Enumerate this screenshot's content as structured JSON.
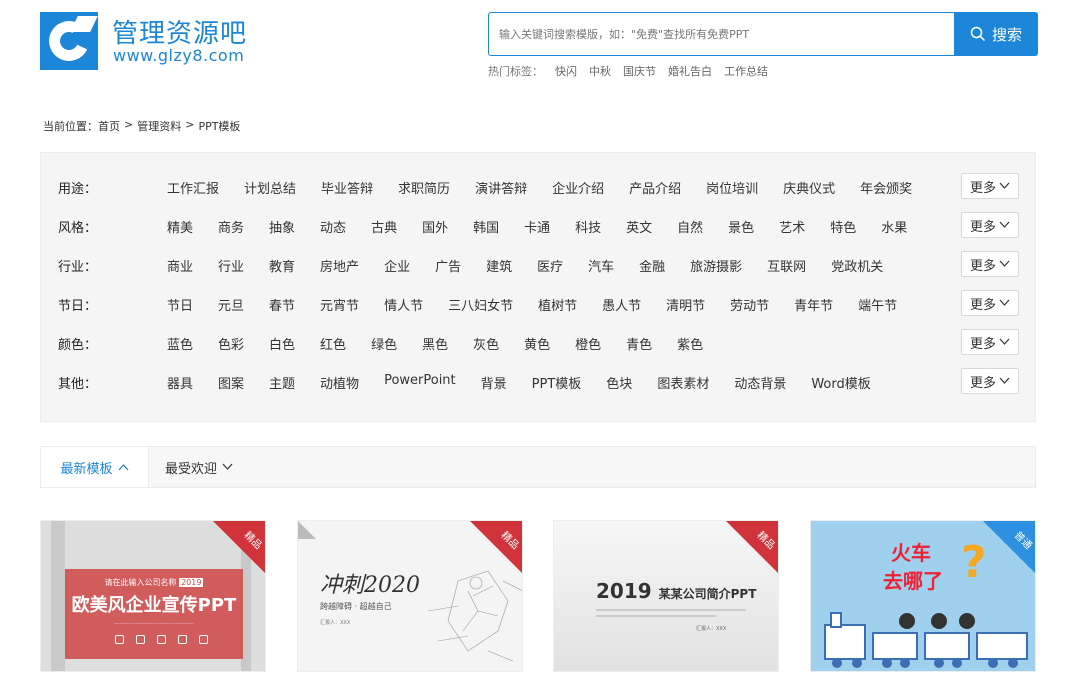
{
  "logo": {
    "title": "管理资源吧",
    "url": "www.glzy8.com"
  },
  "search": {
    "placeholder": "输入关键词搜索模版，如：\"免费\"查找所有免费PPT",
    "button_label": "搜索",
    "hot_label": "热门标签：",
    "hot_tags": [
      "快闪",
      "中秋",
      "国庆节",
      "婚礼告白",
      "工作总结"
    ]
  },
  "breadcrumb": {
    "label": "当前位置：",
    "items": [
      "首页",
      "管理资料",
      "PPT模板"
    ],
    "sep": ">"
  },
  "filters": {
    "more_label": "更多",
    "rows": [
      {
        "name": "用途：",
        "options": [
          "工作汇报",
          "计划总结",
          "毕业答辩",
          "求职简历",
          "演讲答辩",
          "企业介绍",
          "产品介绍",
          "岗位培训",
          "庆典仪式",
          "年会颁奖"
        ]
      },
      {
        "name": "风格：",
        "options": [
          "精美",
          "商务",
          "抽象",
          "动态",
          "古典",
          "国外",
          "韩国",
          "卡通",
          "科技",
          "英文",
          "自然",
          "景色",
          "艺术",
          "特色",
          "水果"
        ]
      },
      {
        "name": "行业：",
        "options": [
          "商业",
          "行业",
          "教育",
          "房地产",
          "企业",
          "广告",
          "建筑",
          "医疗",
          "汽车",
          "金融",
          "旅游摄影",
          "互联网",
          "党政机关"
        ]
      },
      {
        "name": "节日：",
        "options": [
          "节日",
          "元旦",
          "春节",
          "元宵节",
          "情人节",
          "三八妇女节",
          "植树节",
          "愚人节",
          "清明节",
          "劳动节",
          "青年节",
          "端午节"
        ]
      },
      {
        "name": "颜色：",
        "options": [
          "蓝色",
          "色彩",
          "白色",
          "红色",
          "绿色",
          "黑色",
          "灰色",
          "黄色",
          "橙色",
          "青色",
          "紫色"
        ]
      },
      {
        "name": "其他：",
        "options": [
          "器具",
          "图案",
          "主题",
          "动植物",
          "PowerPoint",
          "背景",
          "PPT模板",
          "色块",
          "图表素材",
          "动态背景",
          "Word模板"
        ]
      }
    ]
  },
  "sort": {
    "active": "最新模板",
    "other": "最受欢迎"
  },
  "cards": [
    {
      "badge": "精品",
      "sub": "请在此输入公司名称",
      "year": "2019",
      "title": "欧美风企业宣传PPT",
      "accent": "#d0343a"
    },
    {
      "badge": "精品",
      "title": "冲刺2020",
      "sub": "跨越障碍 · 超越自己",
      "reporter": "汇报人：XXX",
      "accent": "#d0343a"
    },
    {
      "badge": "精品",
      "year": "2019",
      "title": "某某公司简介PPT",
      "reporter": "汇报人：XXX",
      "accent": "#d0343a"
    },
    {
      "badge": "普通",
      "title1": "火车",
      "title2": "去哪了",
      "mark": "?",
      "accent": "#2d8fe0"
    }
  ],
  "colors": {
    "brand": "#1c86d8",
    "filter_bg": "#f5f5f5"
  }
}
